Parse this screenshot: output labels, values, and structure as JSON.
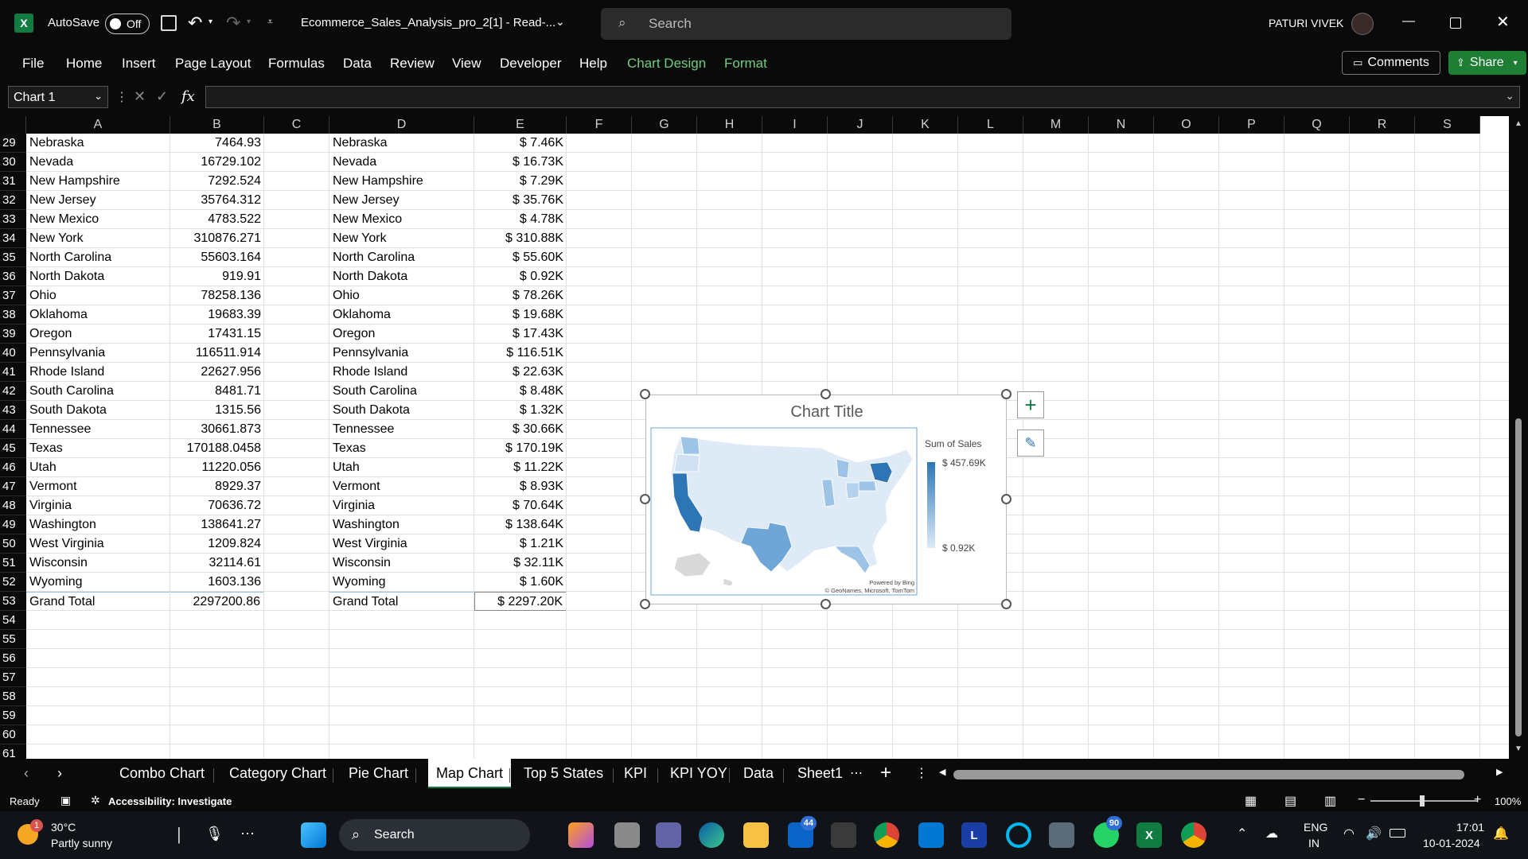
{
  "titlebar": {
    "autosave_label": "AutoSave",
    "autosave_state": "Off",
    "filename": "Ecommerce_Sales_Analysis_pro_2[1]  -  Read-...",
    "search_placeholder": "Search",
    "user_name": "PATURI VIVEK"
  },
  "menu": {
    "file": "File",
    "home": "Home",
    "insert": "Insert",
    "page_layout": "Page Layout",
    "formulas": "Formulas",
    "data": "Data",
    "review": "Review",
    "view": "View",
    "developer": "Developer",
    "help": "Help",
    "chart_design": "Chart Design",
    "format": "Format",
    "comments": "Comments",
    "share": "Share"
  },
  "formula_bar": {
    "name_box": "Chart 1",
    "fx": "fx",
    "formula": ""
  },
  "columns": [
    "A",
    "B",
    "C",
    "D",
    "E",
    "F",
    "G",
    "H",
    "I",
    "J",
    "K",
    "L",
    "M",
    "N",
    "O",
    "P",
    "Q",
    "R",
    "S"
  ],
  "rows": [
    {
      "n": "29",
      "a": "Nebraska",
      "b": "7464.93",
      "d": "Nebraska",
      "e": "$ 7.46K"
    },
    {
      "n": "30",
      "a": "Nevada",
      "b": "16729.102",
      "d": "Nevada",
      "e": "$ 16.73K"
    },
    {
      "n": "31",
      "a": "New Hampshire",
      "b": "7292.524",
      "d": "New Hampshire",
      "e": "$ 7.29K"
    },
    {
      "n": "32",
      "a": "New Jersey",
      "b": "35764.312",
      "d": "New Jersey",
      "e": "$ 35.76K"
    },
    {
      "n": "33",
      "a": "New Mexico",
      "b": "4783.522",
      "d": "New Mexico",
      "e": "$ 4.78K"
    },
    {
      "n": "34",
      "a": "New York",
      "b": "310876.271",
      "d": "New York",
      "e": "$ 310.88K"
    },
    {
      "n": "35",
      "a": "North Carolina",
      "b": "55603.164",
      "d": "North Carolina",
      "e": "$ 55.60K"
    },
    {
      "n": "36",
      "a": "North Dakota",
      "b": "919.91",
      "d": "North Dakota",
      "e": "$ 0.92K"
    },
    {
      "n": "37",
      "a": "Ohio",
      "b": "78258.136",
      "d": "Ohio",
      "e": "$ 78.26K"
    },
    {
      "n": "38",
      "a": "Oklahoma",
      "b": "19683.39",
      "d": "Oklahoma",
      "e": "$ 19.68K"
    },
    {
      "n": "39",
      "a": "Oregon",
      "b": "17431.15",
      "d": "Oregon",
      "e": "$ 17.43K"
    },
    {
      "n": "40",
      "a": "Pennsylvania",
      "b": "116511.914",
      "d": "Pennsylvania",
      "e": "$ 116.51K"
    },
    {
      "n": "41",
      "a": "Rhode Island",
      "b": "22627.956",
      "d": "Rhode Island",
      "e": "$ 22.63K"
    },
    {
      "n": "42",
      "a": "South Carolina",
      "b": "8481.71",
      "d": "South Carolina",
      "e": "$ 8.48K"
    },
    {
      "n": "43",
      "a": "South Dakota",
      "b": "1315.56",
      "d": "South Dakota",
      "e": "$ 1.32K"
    },
    {
      "n": "44",
      "a": "Tennessee",
      "b": "30661.873",
      "d": "Tennessee",
      "e": "$ 30.66K"
    },
    {
      "n": "45",
      "a": "Texas",
      "b": "170188.0458",
      "d": "Texas",
      "e": "$ 170.19K"
    },
    {
      "n": "46",
      "a": "Utah",
      "b": "11220.056",
      "d": "Utah",
      "e": "$ 11.22K"
    },
    {
      "n": "47",
      "a": "Vermont",
      "b": "8929.37",
      "d": "Vermont",
      "e": "$ 8.93K"
    },
    {
      "n": "48",
      "a": "Virginia",
      "b": "70636.72",
      "d": "Virginia",
      "e": "$ 70.64K"
    },
    {
      "n": "49",
      "a": "Washington",
      "b": "138641.27",
      "d": "Washington",
      "e": "$ 138.64K"
    },
    {
      "n": "50",
      "a": "West Virginia",
      "b": "1209.824",
      "d": "West Virginia",
      "e": "$ 1.21K"
    },
    {
      "n": "51",
      "a": "Wisconsin",
      "b": "32114.61",
      "d": "Wisconsin",
      "e": "$ 32.11K"
    },
    {
      "n": "52",
      "a": "Wyoming",
      "b": "1603.136",
      "d": "Wyoming",
      "e": "$ 1.60K"
    },
    {
      "n": "53",
      "a": "Grand Total",
      "b": "2297200.86",
      "d": "Grand Total",
      "e": "$ 2297.20K"
    },
    {
      "n": "54",
      "a": "",
      "b": "",
      "d": "",
      "e": ""
    },
    {
      "n": "55",
      "a": "",
      "b": "",
      "d": "",
      "e": ""
    },
    {
      "n": "56",
      "a": "",
      "b": "",
      "d": "",
      "e": ""
    },
    {
      "n": "57",
      "a": "",
      "b": "",
      "d": "",
      "e": ""
    },
    {
      "n": "58",
      "a": "",
      "b": "",
      "d": "",
      "e": ""
    },
    {
      "n": "59",
      "a": "",
      "b": "",
      "d": "",
      "e": ""
    },
    {
      "n": "60",
      "a": "",
      "b": "",
      "d": "",
      "e": ""
    },
    {
      "n": "61",
      "a": "",
      "b": "",
      "d": "",
      "e": ""
    }
  ],
  "chart": {
    "title": "Chart Title",
    "legend_title": "Sum  of Sales",
    "legend_max": "$ 457.69K",
    "legend_min": "$ 0.92K",
    "powered_by": "Powered by Bing",
    "attribution": "© GeoNames, Microsoft, TomTom",
    "color_high": "#2e75b6",
    "color_low": "#deebf7"
  },
  "sheet_tabs": [
    "Combo Chart",
    "Category Chart",
    "Pie Chart",
    "Map Chart",
    "Top 5 States",
    "KPI",
    "KPI YOY",
    "Data",
    "Sheet1"
  ],
  "active_tab": "Map Chart",
  "status": {
    "ready": "Ready",
    "accessibility": "Accessibility: Investigate",
    "zoom": "100%"
  },
  "taskbar": {
    "weather_temp": "30°C",
    "weather_desc": "Partly sunny",
    "weather_badge": "1",
    "search": "Search",
    "mail_badge": "44",
    "whatsapp_badge": "90",
    "lang_top": "ENG",
    "lang_bottom": "IN",
    "time": "17:01",
    "date": "10-01-2024"
  }
}
